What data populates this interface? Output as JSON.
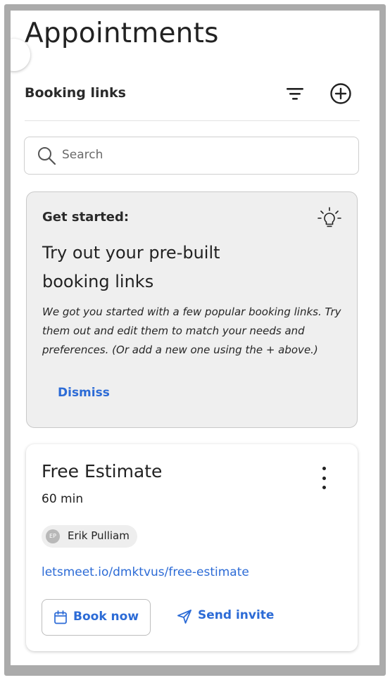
{
  "page": {
    "title": "Appointments"
  },
  "header": {
    "section_title": "Booking links",
    "filter_icon": "filter-icon",
    "add_icon": "add-circle-icon"
  },
  "search": {
    "placeholder": "Search",
    "value": "",
    "icon": "search-icon"
  },
  "tip_card": {
    "label": "Get started:",
    "headline": "Try out your pre-built booking links",
    "body": "We got you started with a few popular booking links. Try them out and edit them to match your needs and preferences. (Or add a new one using the + above.)",
    "dismiss_label": "Dismiss",
    "icon": "lightbulb-icon"
  },
  "booking_links": [
    {
      "title": "Free Estimate",
      "duration": "60 min",
      "owner_initials": "EP",
      "owner_name": "Erik Pulliam",
      "url": "letsmeet.io/dmktvus/free-estimate",
      "book_label": "Book now",
      "invite_label": "Send invite",
      "menu_icon": "more-vertical-icon",
      "book_icon": "calendar-icon",
      "invite_icon": "send-icon"
    }
  ],
  "colors": {
    "accent": "#2c6bd6",
    "text": "#222222",
    "tip_background": "#efefef",
    "frame": "#ababab"
  }
}
